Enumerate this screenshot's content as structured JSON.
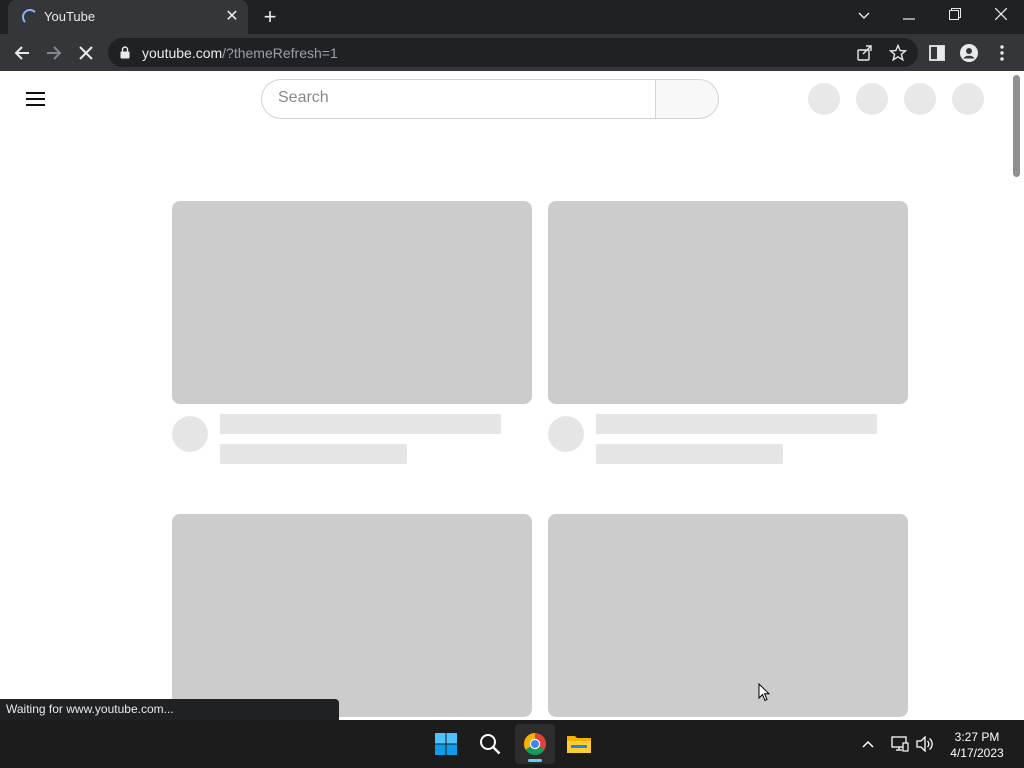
{
  "browser": {
    "tab": {
      "title": "YouTube"
    },
    "address": {
      "host": "youtube.com",
      "path": "/?themeRefresh=1"
    },
    "status_text": "Waiting for www.youtube.com..."
  },
  "youtube": {
    "search": {
      "placeholder": "Search"
    }
  },
  "taskbar": {
    "time": "3:27 PM",
    "date": "4/17/2023"
  },
  "colors": {
    "chrome_frame": "#202124",
    "chrome_toolbar": "#35363a",
    "skeleton_thumbnail": "#cccccc",
    "skeleton_line": "#e5e5e5",
    "taskbar": "#1c1c1c"
  }
}
